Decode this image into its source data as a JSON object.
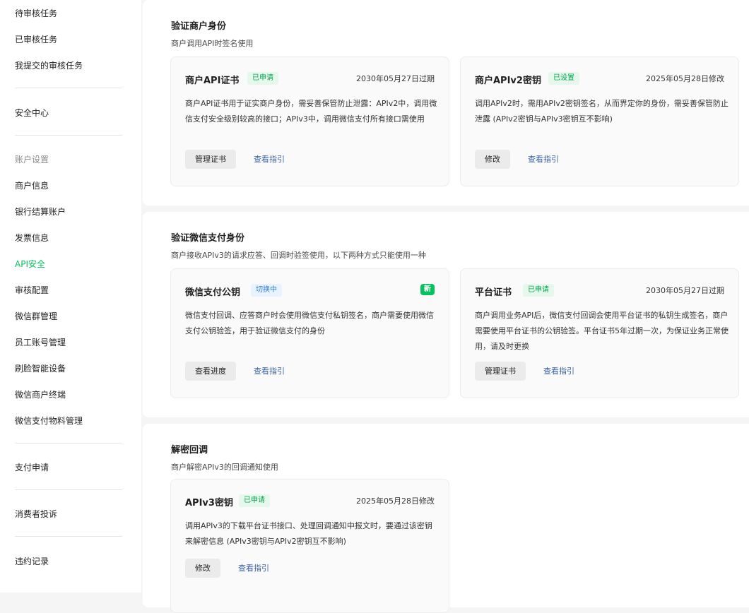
{
  "sidebar": {
    "task_items": [
      "待审核任务",
      "已审核任务",
      "我提交的审核任务"
    ],
    "security_center": "安全中心",
    "account_group_title": "账户设置",
    "account_items": [
      "商户信息",
      "银行结算账户",
      "发票信息",
      "API安全",
      "审核配置",
      "微信群管理",
      "员工账号管理",
      "刷脸智能设备",
      "微信商户终端",
      "微信支付物料管理"
    ],
    "active_item": "API安全",
    "pay_apply": "支付申请",
    "consumer_complaint": "消费者投诉",
    "violation_record": "违约记录"
  },
  "sections": [
    {
      "title": "验证商户身份",
      "desc": "商户调用API时签名使用",
      "cards": [
        {
          "title": "商户API证书",
          "badge": "已申请",
          "meta": "2030年05月27日过期",
          "desc": "商户API证书用于证实商户身份，需妥善保管防止泄露：APIv2中，调用微信支付安全级别较高的接口；APIv3中，调用微信支付所有接口需使用",
          "button": "管理证书",
          "link": "查看指引"
        },
        {
          "title": "商户APIv2密钥",
          "badge": "已设置",
          "meta": "2025年05月28日修改",
          "desc": "调用APIv2时，需用APIv2密钥签名，从而界定你的身份，需妥善保管防止泄露 (APIv2密钥与APIv3密钥互不影响)",
          "button": "修改",
          "link": "查看指引"
        }
      ]
    },
    {
      "title": "验证微信支付身份",
      "desc": "商户接收APIv3的请求应答、回调时验签使用，以下两种方式只能使用一种",
      "cards": [
        {
          "title": "微信支付公钥",
          "badge": "切换中",
          "new_badge": "新",
          "desc": "微信支付回调、应答商户时会使用微信支付私钥签名，商户需要使用微信支付公钥验签，用于验证微信支付的身份",
          "button": "查看进度",
          "link": "查看指引"
        },
        {
          "title": "平台证书",
          "badge": "已申请",
          "meta": "2030年05月27日过期",
          "desc": "商户调用业务API后，微信支付回调会使用平台证书的私钥生成签名，商户需要使用平台证书的公钥验签。平台证书5年过期一次，为保证业务正常使用，请及时更换",
          "button": "管理证书",
          "link": "查看指引"
        }
      ]
    },
    {
      "title": "解密回调",
      "desc": "商户解密APIv3的回调通知使用",
      "cards": [
        {
          "title": "APIv3密钥",
          "badge": "已申请",
          "meta": "2025年05月28日修改",
          "desc": "调用APIv3的下载平台证书接口、处理回调通知中报文时，要通过该密钥来解密信息 (APIv3密钥与APIv2密钥互不影响)",
          "button": "修改",
          "link": "查看指引"
        }
      ]
    }
  ]
}
